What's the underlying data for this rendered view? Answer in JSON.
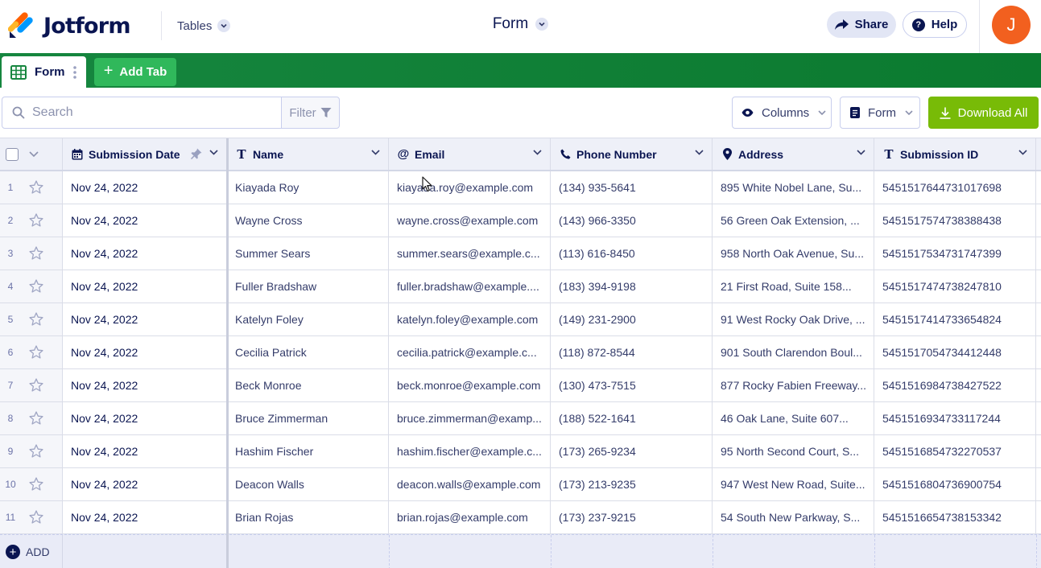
{
  "header": {
    "brand": "Jotform",
    "tables_menu_label": "Tables",
    "page_title": "Form",
    "share_label": "Share",
    "help_label": "Help",
    "avatar_initial": "J"
  },
  "tabs": {
    "active_tab_label": "Form",
    "add_tab_label": "Add Tab"
  },
  "toolbar": {
    "search_placeholder": "Search",
    "filter_label": "Filter",
    "columns_label": "Columns",
    "view_label": "Form",
    "download_label": "Download All"
  },
  "table": {
    "columns": [
      {
        "label": "Submission Date",
        "icon": "calendar-icon"
      },
      {
        "label": "Name",
        "icon": "text-type-icon"
      },
      {
        "label": "Email",
        "icon": "at-sign-icon"
      },
      {
        "label": "Phone Number",
        "icon": "phone-icon"
      },
      {
        "label": "Address",
        "icon": "map-pin-icon"
      },
      {
        "label": "Submission ID",
        "icon": "text-type-icon"
      }
    ],
    "rows": [
      {
        "num": "1",
        "date": "Nov 24, 2022",
        "name": "Kiayada Roy",
        "email": "kiayada.roy@example.com",
        "phone": "(134) 935-5641",
        "address": "895 White Nobel Lane, Su...",
        "id": "5451517644731017698"
      },
      {
        "num": "2",
        "date": "Nov 24, 2022",
        "name": "Wayne Cross",
        "email": "wayne.cross@example.com",
        "phone": "(143) 966-3350",
        "address": "56 Green Oak Extension, ...",
        "id": "5451517574738388438"
      },
      {
        "num": "3",
        "date": "Nov 24, 2022",
        "name": "Summer Sears",
        "email": "summer.sears@example.c...",
        "phone": "(113) 616-8450",
        "address": "958 North Oak Avenue, Su...",
        "id": "5451517534731747399"
      },
      {
        "num": "4",
        "date": "Nov 24, 2022",
        "name": "Fuller Bradshaw",
        "email": "fuller.bradshaw@example....",
        "phone": "(183) 394-9198",
        "address": "21 First Road, Suite 158...",
        "id": "5451517474738247810"
      },
      {
        "num": "5",
        "date": "Nov 24, 2022",
        "name": "Katelyn Foley",
        "email": "katelyn.foley@example.com",
        "phone": "(149) 231-2900",
        "address": "91 West Rocky Oak Drive, ...",
        "id": "5451517414733654824"
      },
      {
        "num": "6",
        "date": "Nov 24, 2022",
        "name": "Cecilia Patrick",
        "email": "cecilia.patrick@example.c...",
        "phone": "(118) 872-8544",
        "address": "901 South Clarendon Boul...",
        "id": "5451517054734412448"
      },
      {
        "num": "7",
        "date": "Nov 24, 2022",
        "name": "Beck Monroe",
        "email": "beck.monroe@example.com",
        "phone": "(130) 473-7515",
        "address": "877 Rocky Fabien Freeway...",
        "id": "5451516984738427522"
      },
      {
        "num": "8",
        "date": "Nov 24, 2022",
        "name": "Bruce Zimmerman",
        "email": "bruce.zimmerman@examp...",
        "phone": "(188) 522-1641",
        "address": "46 Oak Lane, Suite 607...",
        "id": "5451516934733117244"
      },
      {
        "num": "9",
        "date": "Nov 24, 2022",
        "name": "Hashim Fischer",
        "email": "hashim.fischer@example.c...",
        "phone": "(173) 265-9234",
        "address": "95 North Second Court, S...",
        "id": "5451516854732270537"
      },
      {
        "num": "10",
        "date": "Nov 24, 2022",
        "name": "Deacon Walls",
        "email": "deacon.walls@example.com",
        "phone": "(173) 213-9235",
        "address": "947 West New Road, Suite...",
        "id": "5451516804736900754"
      },
      {
        "num": "11",
        "date": "Nov 24, 2022",
        "name": "Brian Rojas",
        "email": "brian.rojas@example.com",
        "phone": "(173) 237-9215",
        "address": "54 South New Parkway, S...",
        "id": "5451516654738153342"
      }
    ],
    "add_row_label": "ADD"
  },
  "colors": {
    "brand_navy": "#0a1551",
    "tab_bar_green": "#0b7a2f",
    "add_tab_green": "#30b85b",
    "download_green": "#78bb07",
    "avatar_orange": "#f2601f"
  }
}
